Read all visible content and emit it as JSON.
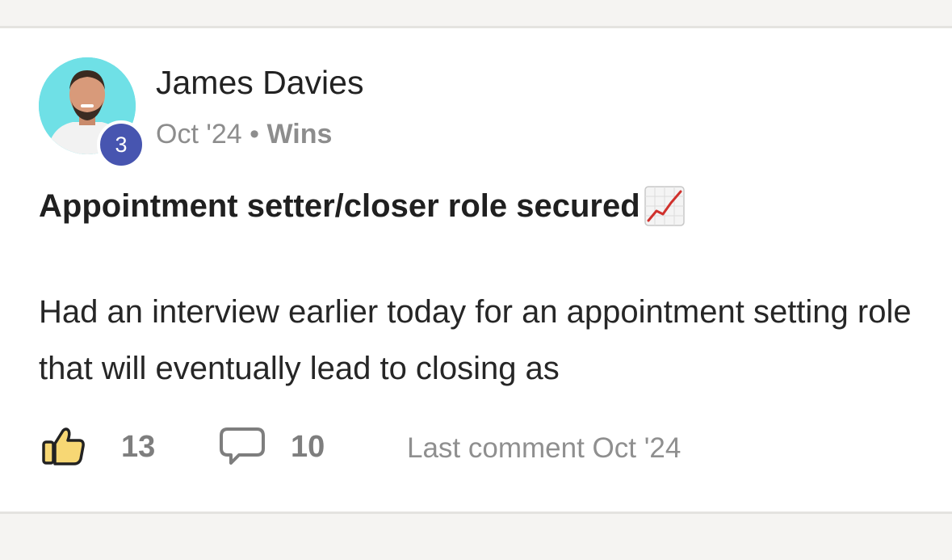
{
  "post": {
    "author": {
      "name": "James Davies",
      "level": "3",
      "avatar": "avatar-photo"
    },
    "meta": {
      "date": "Oct '24",
      "separator": " • ",
      "category": "Wins"
    },
    "title": "Appointment setter/closer role secured",
    "title_emoji": "chart-increasing-icon",
    "body": "Had an interview earlier today for an appointment setting role that will eventually lead to closing as",
    "actions": {
      "likes": "13",
      "comments": "10",
      "last_comment": "Last comment Oct '24"
    }
  },
  "colors": {
    "badge": "#4755b0",
    "avatar_bg": "#6fe0e6",
    "muted_text": "#8d8d8d",
    "like_icon_fill": "#f7d774"
  }
}
